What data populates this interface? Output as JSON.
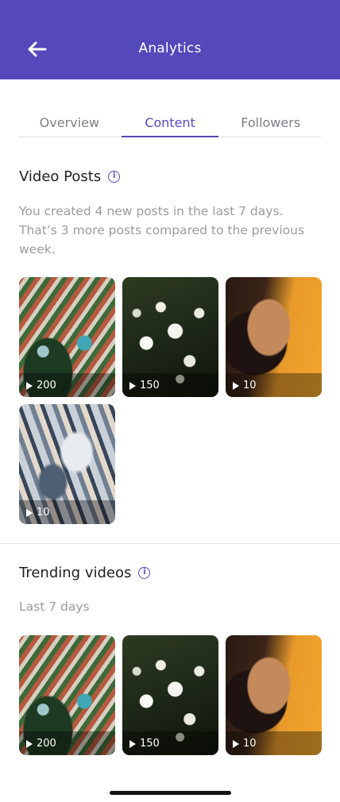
{
  "header": {
    "title": "Analytics",
    "back_icon": "arrow-left-icon"
  },
  "tabs": [
    {
      "label": "Overview",
      "active": false
    },
    {
      "label": "Content",
      "active": true
    },
    {
      "label": "Followers",
      "active": false
    }
  ],
  "video_posts": {
    "title": "Video Posts",
    "description": "You created 4 new posts in the last 7 days. That’s 3 more posts compared to the previous week.",
    "items": [
      {
        "image": "aerial-resort",
        "views": "200"
      },
      {
        "image": "daisies",
        "views": "150"
      },
      {
        "image": "woman-portrait",
        "views": "10"
      },
      {
        "image": "abstract-swirl",
        "views": "10"
      }
    ]
  },
  "trending": {
    "title": "Trending videos",
    "subtitle": "Last 7 days",
    "items": [
      {
        "image": "aerial-resort",
        "views": "200"
      },
      {
        "image": "daisies",
        "views": "150"
      },
      {
        "image": "woman-portrait",
        "views": "10"
      }
    ]
  },
  "colors": {
    "accent": "#5548ba",
    "muted_text": "#9a9aa2"
  }
}
